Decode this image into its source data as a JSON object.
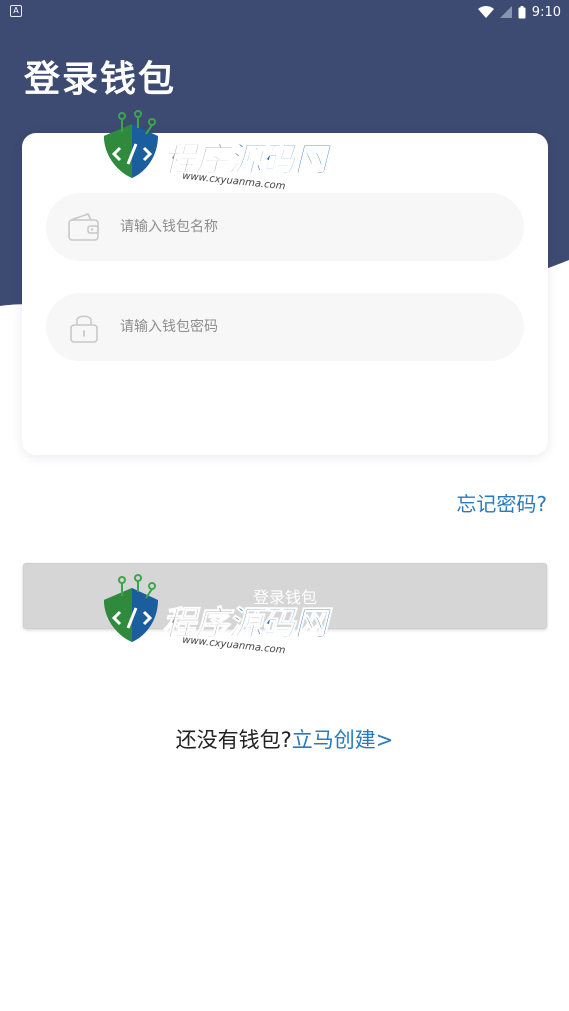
{
  "status_bar": {
    "left_icon": "A",
    "time": "9:10",
    "icons": [
      "wifi-icon",
      "signal-icon",
      "battery-icon"
    ]
  },
  "header": {
    "title": "登录钱包"
  },
  "form": {
    "wallet_name": {
      "placeholder": "请输入钱包名称",
      "value": "",
      "icon": "wallet-icon"
    },
    "wallet_password": {
      "placeholder": "请输入钱包密码",
      "value": "",
      "icon": "lock-icon"
    }
  },
  "forgot_password": "忘记密码?",
  "login_button": "登录钱包",
  "register": {
    "prompt": "还没有钱包?",
    "link": "立马创建>"
  },
  "watermark": {
    "text_gray": "程序",
    "text_blue": "源码网",
    "url": "www.cxyuanma.com"
  },
  "colors": {
    "header": "#3d4a72",
    "link": "#2a7bbd",
    "button_disabled": "#d6d6d6",
    "field_bg": "#f7f7f7"
  }
}
